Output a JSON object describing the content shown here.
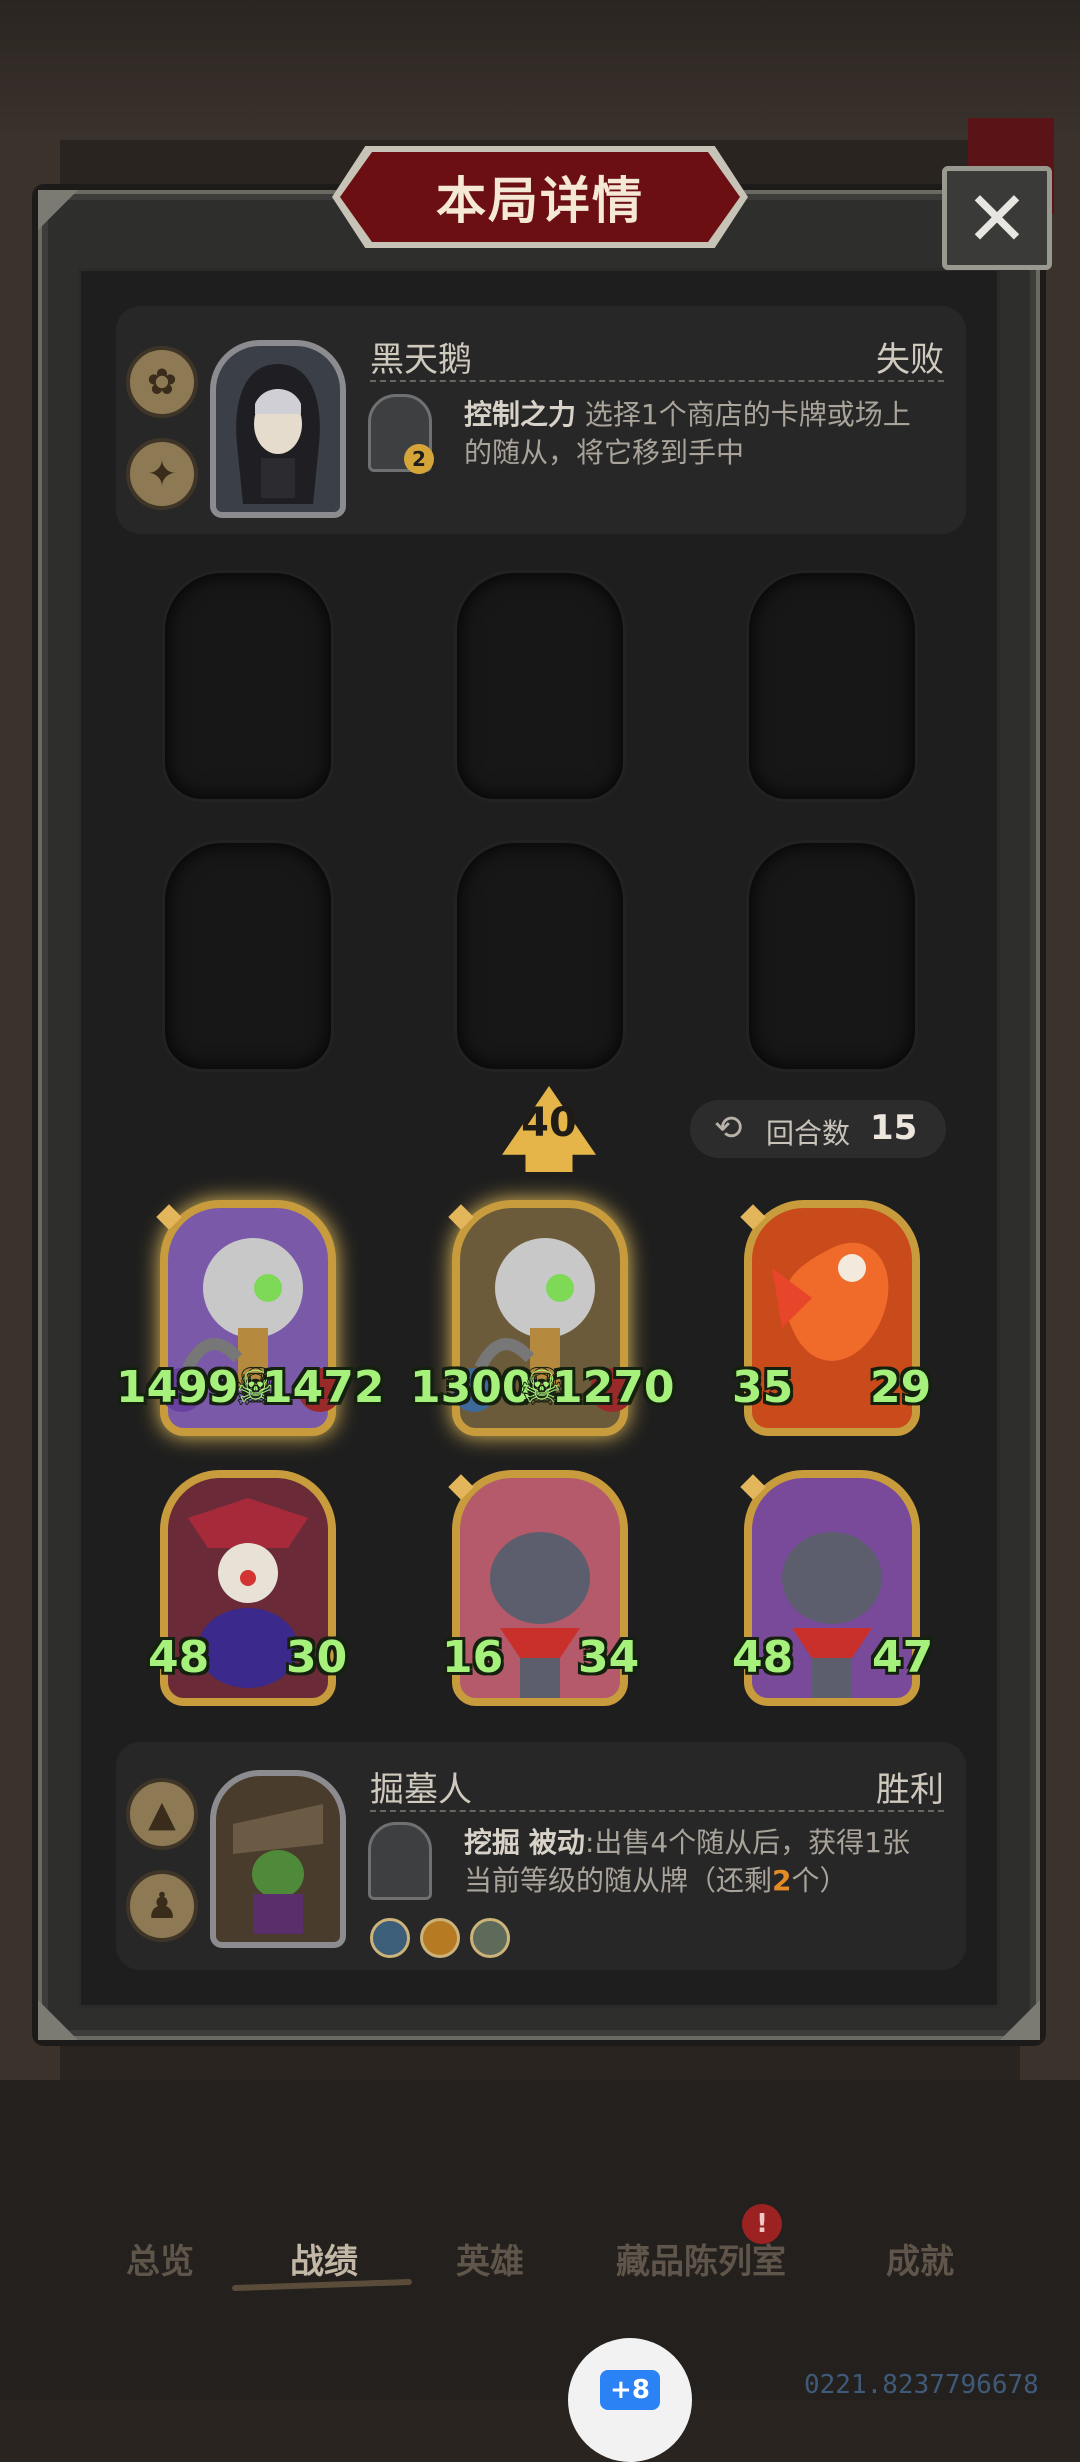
{
  "modal": {
    "title": "本局详情",
    "close_label": "✕"
  },
  "opponent": {
    "name": "黑天鹅",
    "result": "失败",
    "power_name": "控制之力",
    "power_desc_line1": "选择1个商店的卡牌或场上",
    "power_desc_line2": "的随从，将它移到手中",
    "power_count": "2"
  },
  "board": {
    "tier": "40",
    "turns_label": "回合数",
    "turns_value": "15",
    "minions": [
      {
        "attack": "1499",
        "health": "1472",
        "art": "robot-skull"
      },
      {
        "attack": "1300",
        "health": "1270",
        "art": "robot-skull"
      },
      {
        "attack": "35",
        "health": "29",
        "art": "phoenix"
      },
      {
        "attack": "48",
        "health": "30",
        "art": "jester"
      },
      {
        "attack": "16",
        "health": "34",
        "art": "rat-pirate"
      },
      {
        "attack": "48",
        "health": "47",
        "art": "rat-pirate"
      }
    ]
  },
  "player": {
    "name": "掘墓人",
    "result": "胜利",
    "power_name": "挖掘",
    "power_desc_prefix": "被动",
    "power_desc_line1": ":出售4个随从后，获得1张",
    "power_desc_line2_a": "当前等级的随从牌（还剩",
    "power_desc_line2_num": "2",
    "power_desc_line2_b": "个）"
  },
  "nav": {
    "items": [
      "总览",
      "战绩",
      "英雄",
      "藏品陈列室",
      "成就"
    ],
    "active": "战绩",
    "notification": "!"
  },
  "footer": {
    "home_label": "+8",
    "version": "0221.8237796678"
  },
  "colors": {
    "accent_gold": "#c89b3c",
    "stat_green": "#a6f07c",
    "title_red": "#6b0f12"
  }
}
